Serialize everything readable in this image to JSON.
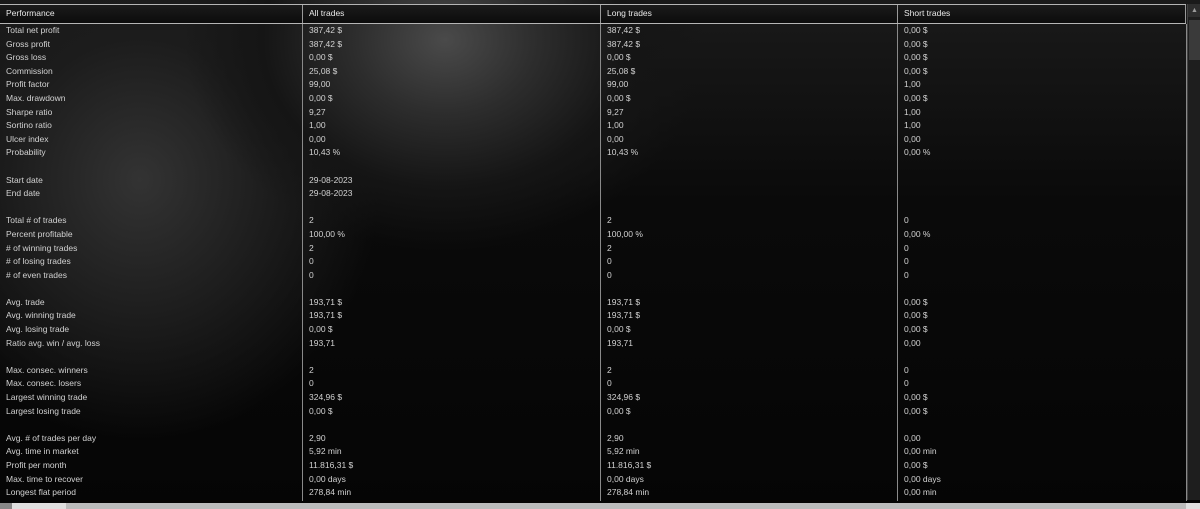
{
  "columns": [
    "Performance",
    "All trades",
    "Long trades",
    "Short trades"
  ],
  "rows": [
    [
      "Total net profit",
      "387,42 $",
      "387,42 $",
      "0,00 $"
    ],
    [
      "Gross profit",
      "387,42 $",
      "387,42 $",
      "0,00 $"
    ],
    [
      "Gross loss",
      "0,00 $",
      "0,00 $",
      "0,00 $"
    ],
    [
      "Commission",
      "25,08 $",
      "25,08 $",
      "0,00 $"
    ],
    [
      "Profit factor",
      "99,00",
      "99,00",
      "1,00"
    ],
    [
      "Max. drawdown",
      "0,00 $",
      "0,00 $",
      "0,00 $"
    ],
    [
      "Sharpe ratio",
      "9,27",
      "9,27",
      "1,00"
    ],
    [
      "Sortino ratio",
      "1,00",
      "1,00",
      "1,00"
    ],
    [
      "Ulcer index",
      "0,00",
      "0,00",
      "0,00"
    ],
    [
      "Probability",
      "10,43 %",
      "10,43 %",
      "0,00 %"
    ],
    [
      "",
      "",
      "",
      ""
    ],
    [
      "Start date",
      "29-08-2023",
      "",
      ""
    ],
    [
      "End date",
      "29-08-2023",
      "",
      ""
    ],
    [
      "",
      "",
      "",
      ""
    ],
    [
      "Total # of trades",
      "2",
      "2",
      "0"
    ],
    [
      "Percent profitable",
      "100,00 %",
      "100,00 %",
      "0,00 %"
    ],
    [
      "# of winning trades",
      "2",
      "2",
      "0"
    ],
    [
      "# of losing trades",
      "0",
      "0",
      "0"
    ],
    [
      "# of even trades",
      "0",
      "0",
      "0"
    ],
    [
      "",
      "",
      "",
      ""
    ],
    [
      "Avg. trade",
      "193,71 $",
      "193,71 $",
      "0,00 $"
    ],
    [
      "Avg. winning trade",
      "193,71 $",
      "193,71 $",
      "0,00 $"
    ],
    [
      "Avg. losing trade",
      "0,00 $",
      "0,00 $",
      "0,00 $"
    ],
    [
      "Ratio avg. win / avg. loss",
      "193,71",
      "193,71",
      "0,00"
    ],
    [
      "",
      "",
      "",
      ""
    ],
    [
      "Max. consec. winners",
      "2",
      "2",
      "0"
    ],
    [
      "Max. consec. losers",
      "0",
      "0",
      "0"
    ],
    [
      "Largest winning trade",
      "324,96 $",
      "324,96 $",
      "0,00 $"
    ],
    [
      "Largest losing trade",
      "0,00 $",
      "0,00 $",
      "0,00 $"
    ],
    [
      "",
      "",
      "",
      ""
    ],
    [
      "Avg. # of trades per day",
      "2,90",
      "2,90",
      "0,00"
    ],
    [
      "Avg. time in market",
      "5,92 min",
      "5,92 min",
      "0,00 min"
    ],
    [
      "Profit per month",
      "11.816,31 $",
      "11.816,31 $",
      "0,00 $"
    ],
    [
      "Max. time to recover",
      "0,00 days",
      "0,00 days",
      "0,00 days"
    ],
    [
      "Longest flat period",
      "278,84 min",
      "278,84 min",
      "0,00 min"
    ]
  ]
}
